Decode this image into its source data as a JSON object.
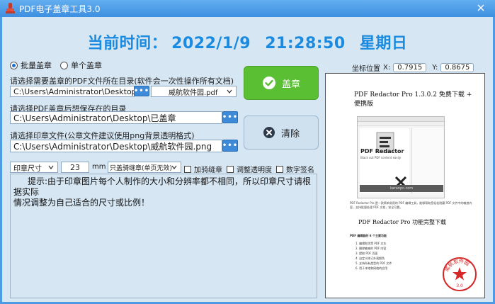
{
  "window": {
    "title": "PDF电子盖章工具3.0",
    "accent_color": "#4d9be4"
  },
  "clock": {
    "label": "当前时间：",
    "date": "2022/1/9",
    "time": "21:28:50",
    "weekday": "星期日",
    "color": "#1a8be0"
  },
  "mode": {
    "batch_label": "批量盖章",
    "single_label": "单个盖章",
    "selected": "批量盖章"
  },
  "source": {
    "label": "请选择需要盖章的PDF文件所在目录(软件会一次性操作所有文档)",
    "path": "C:\\Users\\Administrator\\Desktop",
    "browse_label": "•••",
    "file_selected": "威航软件园.pdf"
  },
  "output": {
    "label": "请选择PDF盖章后想保存在的目录",
    "path": "C:\\Users\\Administrator\\Desktop\\已盖章",
    "browse_label": "•••"
  },
  "seal_file": {
    "label": "请选择印章文件(公章文件建议使用png背景透明格式)",
    "path": "C:\\Users\\Administrator\\Desktop\\威航软件园.png",
    "browse_label": "•••"
  },
  "options": {
    "size_option": "印章尺寸",
    "size_value": "23",
    "size_unit": "mm",
    "placement_option": "只盖骑缝章(单页无效)",
    "check_seam": "加骑缝章",
    "check_transparency": "调整透明度",
    "check_signature": "数字签名"
  },
  "buttons": {
    "stamp": "盖章",
    "clear": "清除",
    "stamp_color": "#5bbf33"
  },
  "hint": {
    "text_line1": "提示:由于印章图片每个人制作的大小和分辨率都不相同，所以印章尺寸请根据实际",
    "text_line2": "情况调整为自己适合的尺寸或比例！"
  },
  "coordinates": {
    "label": "坐标位置",
    "x_label": "X:",
    "x_value": "0.7915",
    "y_label": "Y:",
    "y_value": "0.8675"
  },
  "preview": {
    "doc_title": "PDF Redactor Pro 1.3.0.2 免费下载 + 便携版",
    "screenshot_logo": "PDF Redactor",
    "screenshot_tagline": "Black out PDF content easily",
    "screenshot_watermark": "karanpc.com",
    "paragraph": "PDF Redactor Pro 是一款简单易用的 PDF 编辑工具，能够帮助您轻松隐藏 PDF 文件中的敏感内容，支持批量处理 PDF 文档，安全可靠。",
    "section_title": "PDF Redactor Pro 功能完整下载",
    "list_heading": "PDF 编辑器的 6 个主要功能",
    "list_items": [
      "1.  编辑和涂黑 PDF 文本",
      "2.  删除敏感的 PDF 内容",
      "3.  提取 PDF 页面",
      "4.  自定义修订外观颜色",
      "5.  支持所有类型的 PDF 文件",
      "6.  用于本地和网络的应用"
    ],
    "seal_text": "威航软件园",
    "seal_number": "3.0",
    "seal_color": "#d62828"
  }
}
